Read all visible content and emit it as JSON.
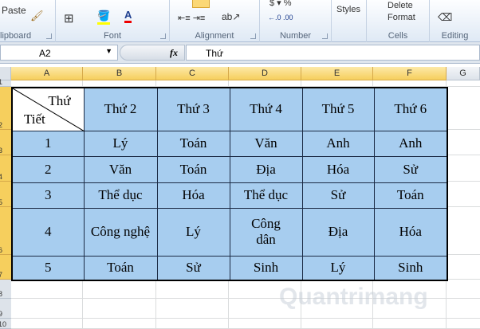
{
  "ribbon": {
    "groups": [
      {
        "label": "lipboard"
      },
      {
        "label": "Font"
      },
      {
        "label": "Alignment"
      },
      {
        "label": "Number"
      },
      {
        "label": "Styles"
      },
      {
        "label": "Cells"
      },
      {
        "label": "Editing"
      }
    ],
    "paste": "Paste",
    "styles": "Styles",
    "cells_delete": "Delete",
    "cells_format": "Format"
  },
  "formula_bar": {
    "name_box": "A2",
    "fx": "fx",
    "value": "Thứ"
  },
  "columns": [
    "A",
    "B",
    "C",
    "D",
    "E",
    "F",
    "G"
  ],
  "rows": [
    "1",
    "2",
    "3",
    "4",
    "5",
    "6",
    "7",
    "8",
    "9",
    "10"
  ],
  "table": {
    "corner_top": "Thứ",
    "corner_bottom": "Tiết",
    "headers": [
      "Thứ 2",
      "Thứ 3",
      "Thứ 4",
      "Thứ 5",
      "Thứ 6"
    ],
    "rows": [
      [
        "1",
        "Lý",
        "Toán",
        "Văn",
        "Anh",
        "Anh"
      ],
      [
        "2",
        "Văn",
        "Toán",
        "Địa",
        "Hóa",
        "Sử"
      ],
      [
        "3",
        "Thể dục",
        "Hóa",
        "Thể dục",
        "Sử",
        "Toán"
      ],
      [
        "4",
        "Công nghệ",
        "Lý",
        "Công dân",
        "Địa",
        "Hóa"
      ],
      [
        "5",
        "Toán",
        "Sử",
        "Sinh",
        "Lý",
        "Sinh"
      ]
    ]
  },
  "watermark": "uantrimang"
}
